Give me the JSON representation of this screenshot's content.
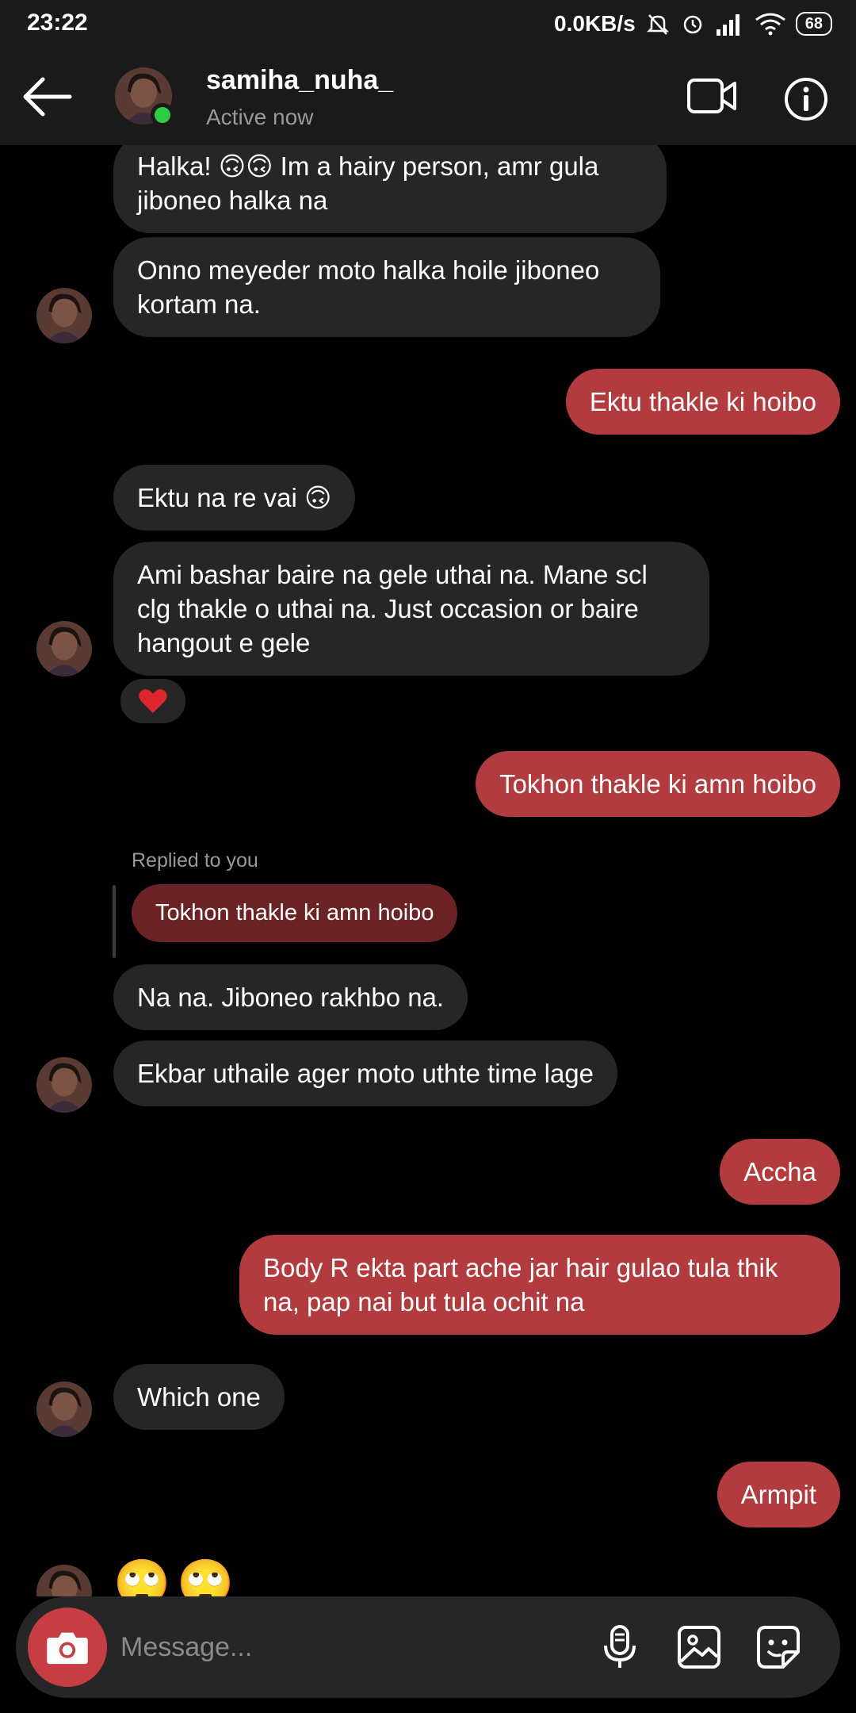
{
  "status_bar": {
    "time": "23:22",
    "net_speed": "0.0KB/s",
    "battery": "68"
  },
  "header": {
    "username": "samiha_nuha_",
    "status": "Active now"
  },
  "messages": {
    "m1": "Halka! 🙃🙃 Im a hairy person, amr gula jiboneo halka na",
    "m2": "Onno meyeder moto halka hoile jiboneo kortam na.",
    "m3": "Ektu thakle ki hoibo",
    "m4": "Ektu na re vai 🙃",
    "m5": "Ami bashar baire na gele uthai na. Mane scl clg thakle o uthai na. Just occasion or baire hangout e gele",
    "m5_reaction": "❤️",
    "m6": "Tokhon thakle ki amn hoibo",
    "reply_label": "Replied to you",
    "reply_quote": "Tokhon thakle ki amn hoibo",
    "m7": "Na na. Jiboneo rakhbo na.",
    "m8": "Ekbar uthaile ager moto uthte time lage",
    "m9": "Accha",
    "m10": "Body R ekta part ache jar hair gulao tula thik na, pap nai but tula ochit na",
    "m11": "Which one",
    "m12": "Armpit",
    "m13_emoji_1": "🙄",
    "m13_emoji_2": "🙄"
  },
  "composer": {
    "placeholder": "Message..."
  },
  "colors": {
    "outgoing_bubble": "#b13b3f",
    "incoming_bubble": "#262626",
    "quoted_bubble": "#6b2325",
    "camera_button": "#c63d43",
    "online": "#2ecc40"
  },
  "icons": [
    "back-arrow-icon",
    "video-call-icon",
    "info-icon",
    "camera-icon",
    "microphone-icon",
    "gallery-icon",
    "sticker-icon",
    "heart-reaction"
  ]
}
